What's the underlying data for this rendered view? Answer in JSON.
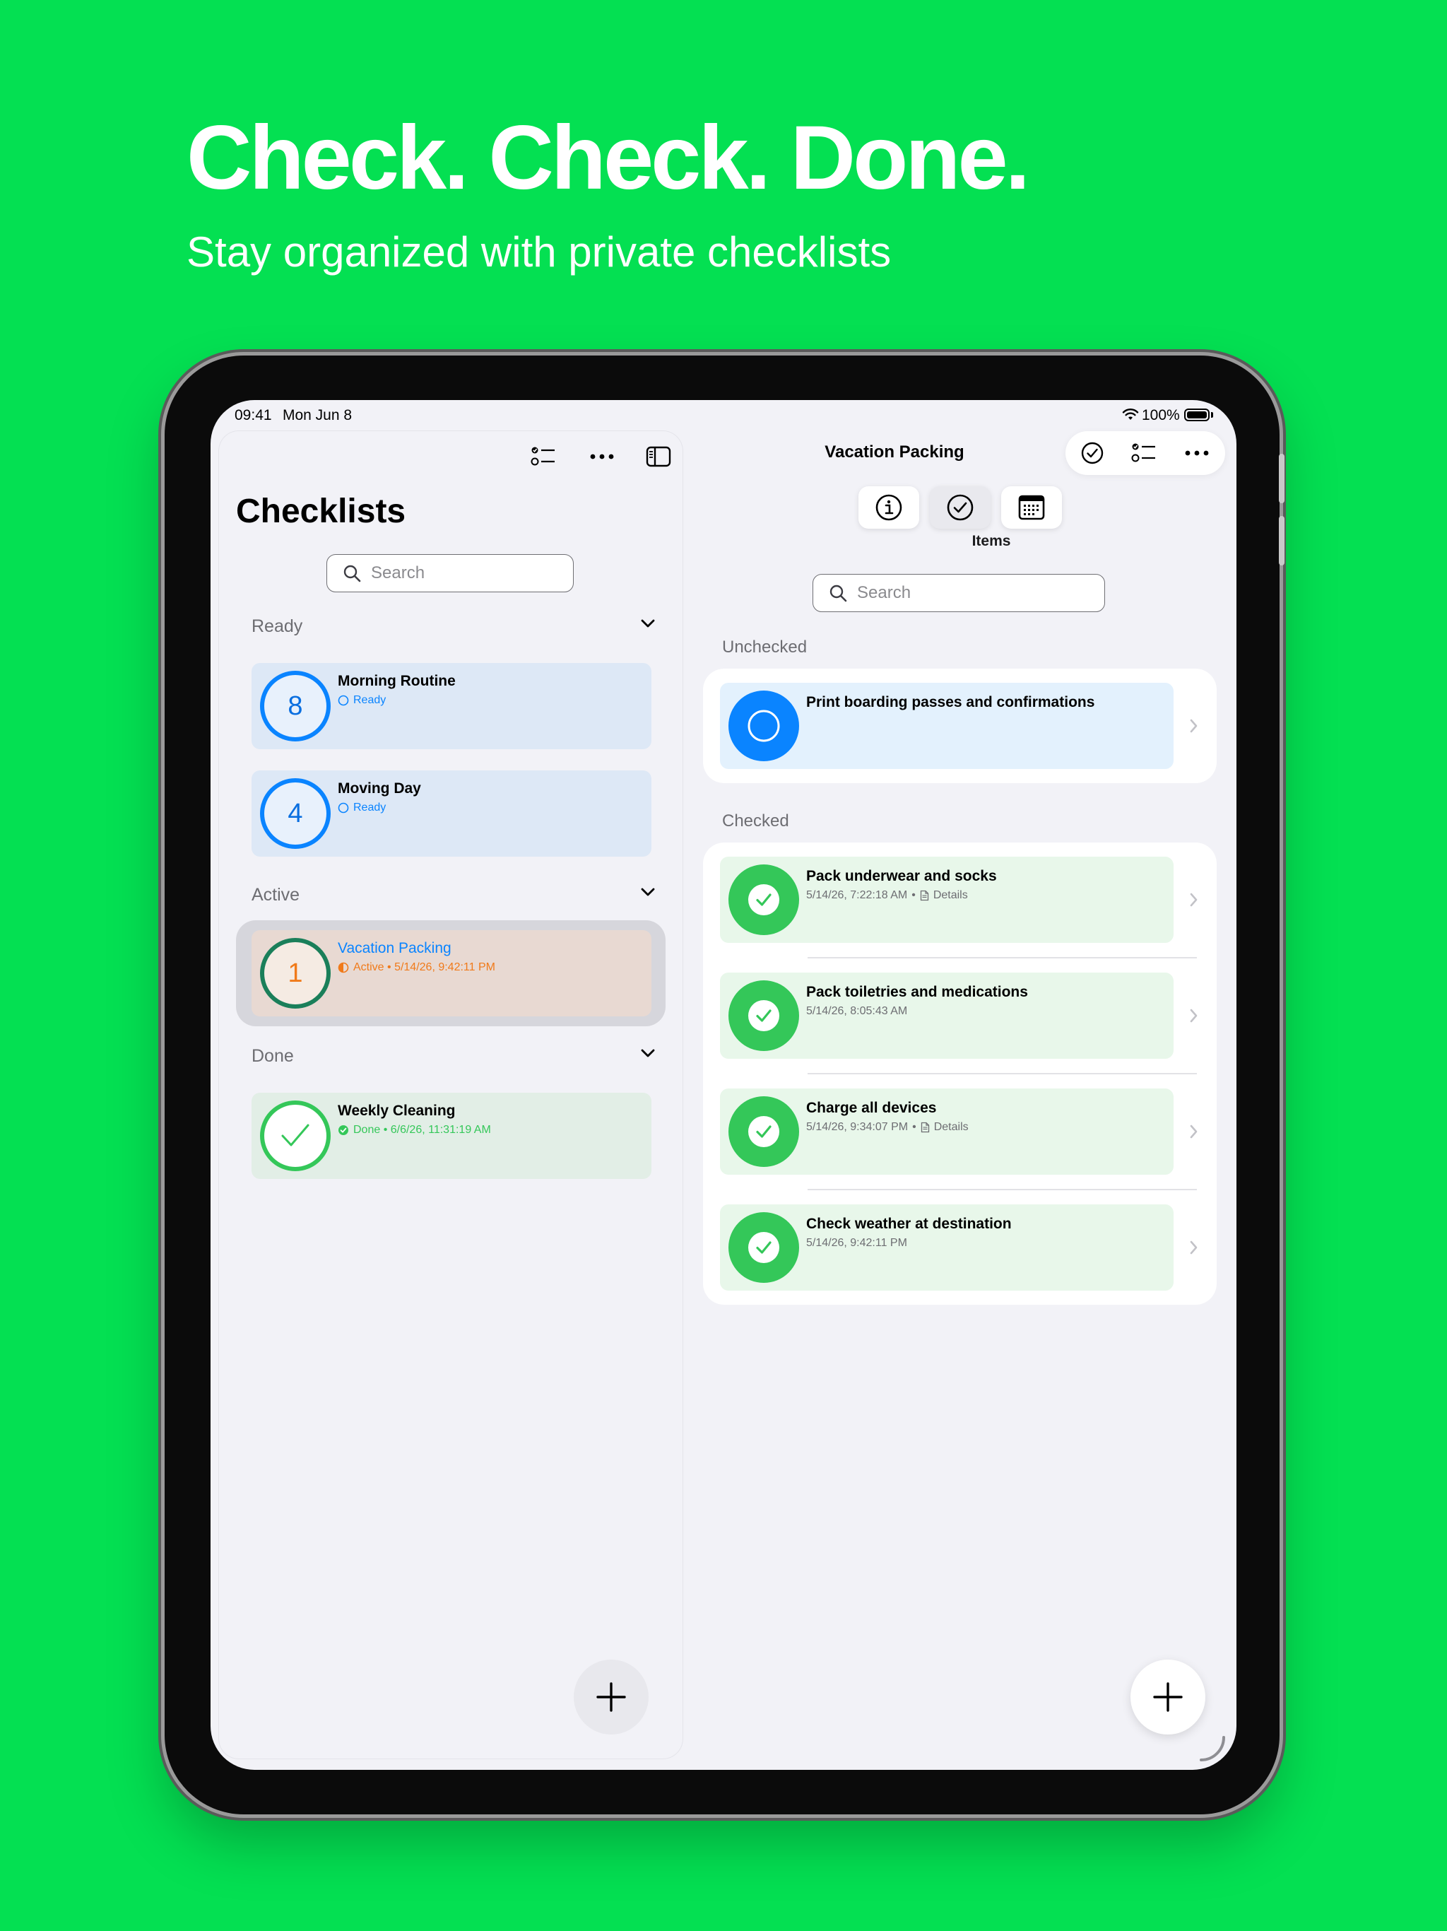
{
  "marketing": {
    "headline": "Check. Check. Done.",
    "subheadline": "Stay organized with private checklists",
    "background_color": "#04e052"
  },
  "status_bar": {
    "time": "09:41",
    "date": "Mon Jun 8",
    "battery": "100%"
  },
  "sidebar": {
    "title": "Checklists",
    "search_placeholder": "Search",
    "sections": [
      {
        "label": "Ready",
        "items": [
          {
            "name": "Morning Routine",
            "count": "8",
            "status": "Ready"
          },
          {
            "name": "Moving Day",
            "count": "4",
            "status": "Ready"
          }
        ]
      },
      {
        "label": "Active",
        "items": [
          {
            "name": "Vacation Packing",
            "count": "1",
            "status": "Active • 5/14/26, 9:42:11 PM",
            "selected": true
          }
        ]
      },
      {
        "label": "Done",
        "items": [
          {
            "name": "Weekly Cleaning",
            "status": "Done • 6/6/26, 11:31:19 AM"
          }
        ]
      }
    ]
  },
  "detail": {
    "title": "Vacation Packing",
    "segments": [
      {
        "icon": "info-icon"
      },
      {
        "icon": "checkmark-circle-icon",
        "label": "Items",
        "selected": true
      },
      {
        "icon": "calendar-icon"
      }
    ],
    "search_placeholder": "Search",
    "unchecked_label": "Unchecked",
    "checked_label": "Checked",
    "unchecked_items": [
      {
        "title": "Print boarding passes and confirmations"
      }
    ],
    "checked_items": [
      {
        "title": "Pack underwear and socks",
        "timestamp": "5/14/26, 7:22:18 AM",
        "details": "Details"
      },
      {
        "title": "Pack toiletries and medications",
        "timestamp": "5/14/26, 8:05:43 AM"
      },
      {
        "title": "Charge all devices",
        "timestamp": "5/14/26, 9:34:07 PM",
        "details": "Details"
      },
      {
        "title": "Check weather at destination",
        "timestamp": "5/14/26, 9:42:11 PM"
      }
    ]
  },
  "colors": {
    "ready_blue": "#0a84ff",
    "active_orange": "#f07a1a",
    "done_green": "#34c759",
    "ready_card": "#dde8f6",
    "active_card": "#e8d9d2",
    "done_card": "#e2eee6"
  }
}
